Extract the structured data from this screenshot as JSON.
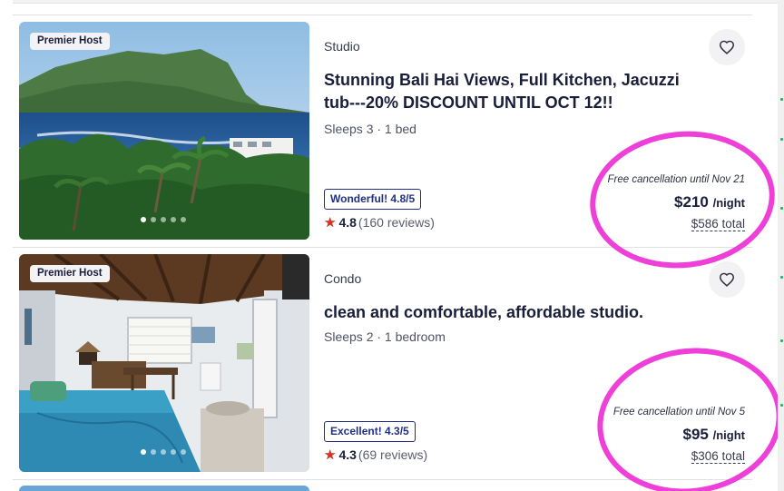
{
  "listings": [
    {
      "badge": "Premier Host",
      "property_type": "Studio",
      "title": "Stunning Bali Hai Views, Full Kitchen, Jacuzzi tub--​-20% DISCOUNT UNTIL OCT 12!!",
      "sleeps": "Sleeps 3 · 1 bed",
      "rating_badge": "Wonderful! 4.8/5",
      "rating": "4.8",
      "reviews": "(160 reviews)",
      "cancellation": "Free cancellation until Nov 21",
      "price": "$210",
      "price_unit": "/night",
      "total": "$586 total",
      "image_dots": 5,
      "active_dot": 0
    },
    {
      "badge": "Premier Host",
      "property_type": "Condo",
      "title": "clean and comfortable, affordable studio.",
      "sleeps": "Sleeps 2 · 1 bedroom",
      "rating_badge": "Excellent! 4.3/5",
      "rating": "4.3",
      "reviews": "(69 reviews)",
      "cancellation": "Free cancellation until Nov 5",
      "price": "$95",
      "price_unit": "/night",
      "total": "$306 total",
      "image_dots": 5,
      "active_dot": 0
    }
  ],
  "icons": {
    "favorite": "heart-icon",
    "rating": "star-icon"
  },
  "colors": {
    "highlight_circle": "#ee3fd8",
    "rating_badge": "#1f2f86",
    "star": "#d9321f"
  }
}
